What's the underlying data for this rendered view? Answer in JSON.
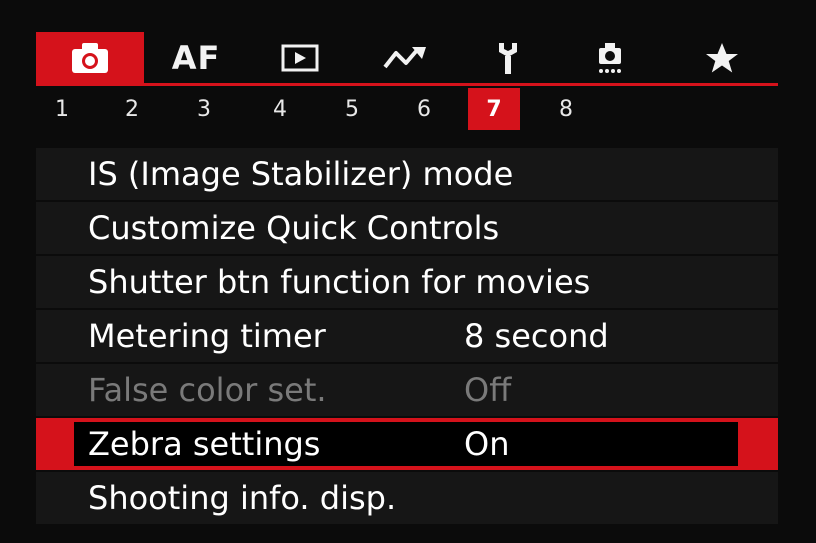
{
  "tabs": [
    {
      "id": "shooting",
      "icon": "camera-icon",
      "active": true
    },
    {
      "id": "af",
      "label": "AF"
    },
    {
      "id": "playback",
      "icon": "playback-icon"
    },
    {
      "id": "wireless",
      "icon": "wireless-icon"
    },
    {
      "id": "setup",
      "icon": "wrench-icon"
    },
    {
      "id": "custom",
      "icon": "custom-functions-icon"
    },
    {
      "id": "mymenu",
      "icon": "star-icon"
    }
  ],
  "pages": [
    "1",
    "2",
    "3",
    "4",
    "5",
    "6",
    "7",
    "8"
  ],
  "active_page": "7",
  "menu": {
    "items": [
      {
        "label": "IS (Image Stabilizer) mode",
        "value": ""
      },
      {
        "label": "Customize Quick Controls",
        "value": ""
      },
      {
        "label": "Shutter btn function for movies",
        "value": ""
      },
      {
        "label": "Metering timer",
        "value": "8 second"
      },
      {
        "label": "False color set.",
        "value": "Off",
        "disabled": true
      },
      {
        "label": "Zebra settings",
        "value": "On",
        "selected": true
      },
      {
        "label": "Shooting info. disp.",
        "value": ""
      }
    ]
  },
  "colors": {
    "accent": "#d5121b",
    "row_bg": "#161616",
    "disabled_text": "#7a7a7a"
  }
}
